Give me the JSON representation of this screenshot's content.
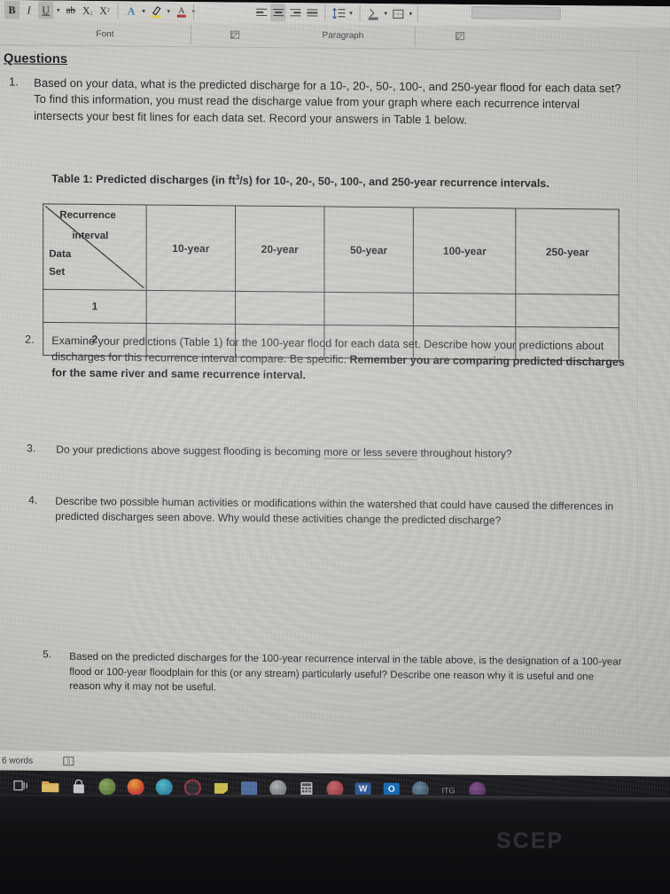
{
  "app": {
    "name": "Microsoft Word",
    "ribbon": {
      "groups": [
        {
          "label": "Font",
          "dialog_launcher": "font-dialog-launcher",
          "buttons": [
            {
              "name": "bold-button",
              "glyph": "B",
              "selected": true
            },
            {
              "name": "italic-button",
              "glyph": "I",
              "selected": false
            },
            {
              "name": "underline-button",
              "glyph": "U",
              "selected": true
            },
            {
              "name": "strikethrough-button",
              "glyph": "ab",
              "selected": false
            },
            {
              "name": "subscript-button",
              "glyph": "X",
              "selected": false
            },
            {
              "name": "superscript-button",
              "glyph": "X",
              "selected": false
            },
            {
              "name": "text-effects-button",
              "glyph": "A",
              "selected": false
            },
            {
              "name": "text-highlight-color-button",
              "glyph": "highlight",
              "selected": false
            },
            {
              "name": "font-color-button",
              "glyph": "A",
              "selected": false
            }
          ]
        },
        {
          "label": "Paragraph",
          "dialog_launcher": "paragraph-dialog-launcher",
          "buttons": [
            {
              "name": "align-left-button",
              "glyph": "align-left",
              "selected": false
            },
            {
              "name": "align-center-button",
              "glyph": "align-center",
              "selected": true
            },
            {
              "name": "align-right-button",
              "glyph": "align-right",
              "selected": false
            },
            {
              "name": "justify-button",
              "glyph": "justify",
              "selected": false
            },
            {
              "name": "line-spacing-button",
              "glyph": "line-spacing",
              "selected": false
            },
            {
              "name": "shading-button",
              "glyph": "shading",
              "selected": false
            },
            {
              "name": "borders-button",
              "glyph": "borders",
              "selected": false
            }
          ]
        }
      ]
    },
    "status_bar": {
      "word_count": "6 words",
      "proofing_icon": "proofing-errors-icon"
    },
    "taskbar": {
      "items": [
        {
          "name": "task-view-button",
          "label": "",
          "color": "#2a2a30",
          "shape": "taskview",
          "active": false
        },
        {
          "name": "file-explorer-button",
          "label": "",
          "color": "#e8b44a",
          "shape": "folder",
          "active": true
        },
        {
          "name": "microsoft-store-button",
          "label": "",
          "color": "#d8d8dc",
          "shape": "bag",
          "active": false
        },
        {
          "name": "chrome-button",
          "label": "",
          "color": "#6f8a4a",
          "shape": "circle",
          "active": false
        },
        {
          "name": "firefox-button",
          "label": "",
          "color": "#e2603a",
          "shape": "circle",
          "active": true
        },
        {
          "name": "edge-button",
          "label": "",
          "color": "#2e9bb5",
          "shape": "circle",
          "active": false
        },
        {
          "name": "opera-button",
          "label": "",
          "color": "#8b2230",
          "shape": "circle",
          "active": false
        },
        {
          "name": "sticky-notes-button",
          "label": "",
          "color": "#d9c84e",
          "shape": "note",
          "active": false
        },
        {
          "name": "teams-button",
          "label": "",
          "color": "#4a6ea8",
          "shape": "sq",
          "active": false
        },
        {
          "name": "photos-button",
          "label": "",
          "color": "#8d8f94",
          "shape": "circle",
          "active": false
        },
        {
          "name": "calculator-button",
          "label": "",
          "color": "#c3c5ca",
          "shape": "grid",
          "active": false
        },
        {
          "name": "discord-button",
          "label": "",
          "color": "#b4404a",
          "shape": "circle",
          "active": false
        },
        {
          "name": "word-button",
          "label": "W",
          "color": "#2b579a",
          "shape": "sq",
          "active": true
        },
        {
          "name": "outlook-button",
          "label": "O",
          "color": "#0f6cbd",
          "shape": "sq",
          "active": false
        },
        {
          "name": "steam-button",
          "label": "",
          "color": "#3f5a73",
          "shape": "circle",
          "active": false
        },
        {
          "name": "epic-games-button",
          "label": "ITG",
          "color": "#4a4a50",
          "shape": "text",
          "active": false
        },
        {
          "name": "app-button",
          "label": "",
          "color": "#6a3a6e",
          "shape": "circle",
          "active": false
        }
      ]
    }
  },
  "document": {
    "heading": "Questions",
    "questions": [
      {
        "number": "1.",
        "segments": [
          {
            "text": "Based on your data, what is the predicted discharge for a 10-, 20-, 50-, 100-, and 250-year flood for each data set?   To find this information, you must read the discharge value from your graph where each recurrence interval intersects your best fit lines for each data set.   Record your answers in Table 1 below.",
            "style": "normal"
          }
        ]
      },
      {
        "number": "2.",
        "segments": [
          {
            "text": "Examine your predictions (Table 1) for the 100-year flood for each data set.  Describe how your predictions about discharges for this recurrence interval compare.  Be specific.  ",
            "style": "normal"
          },
          {
            "text": "Remember you are comparing predicted discharges for the same river and same recurrence interval.",
            "style": "bold"
          }
        ]
      },
      {
        "number": "3.",
        "segments": [
          {
            "text": "Do your predictions above suggest flooding is becoming ",
            "style": "normal"
          },
          {
            "text": "more or less severe",
            "style": "squiggly"
          },
          {
            "text": " throughout history?",
            "style": "normal"
          }
        ]
      },
      {
        "number": "4.",
        "segments": [
          {
            "text": "Describe two possible human activities or modifications within the watershed that could have caused the differences in predicted discharges seen above.  Why would these activities change the predicted discharge?",
            "style": "normal"
          }
        ]
      },
      {
        "number": "5.",
        "segments": [
          {
            "text": "Based on the predicted discharges for the 100-year recurrence interval in the table above, is the designation of a 100-year flood or 100-year floodplain for this (or any stream) particularly useful?  Describe one reason why it is useful and one reason why it may not be useful.",
            "style": "normal"
          }
        ]
      }
    ],
    "table": {
      "caption_prefix": "Table 1:  Predicted discharges (in ft",
      "caption_sup": "3",
      "caption_suffix": "/s) for 10-, 20-, 50-, 100-, and 250-year recurrence intervals.",
      "corner_top_line1": "Recurrence",
      "corner_top_line2": "interval",
      "corner_bottom_line1": "Data",
      "corner_bottom_line2": "Set",
      "columns": [
        "10-year",
        "20-year",
        "50-year",
        "100-year",
        "250-year"
      ],
      "rows": [
        {
          "label": "1",
          "cells": [
            "",
            "",
            "",
            "",
            ""
          ]
        },
        {
          "label": "2",
          "cells": [
            "",
            "",
            "",
            "",
            ""
          ]
        }
      ]
    }
  },
  "monitor": {
    "brand": "SCEP"
  }
}
